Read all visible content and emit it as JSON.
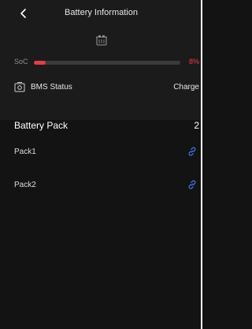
{
  "header": {
    "title": "Battery Information",
    "back_icon": "chevron-left-icon",
    "battery_icon": "battery-icon"
  },
  "soc": {
    "label": "SoC",
    "value_text": "8%",
    "percent": 8,
    "fill_color": "#ea3a48",
    "track_color": "#3a3a3a"
  },
  "bms": {
    "icon": "bms-status-icon",
    "label": "BMS Status",
    "value": "Charge"
  },
  "battery_pack": {
    "title": "Battery Pack",
    "count": "2",
    "packs": [
      {
        "name": "Pack1",
        "icon": "link-icon"
      },
      {
        "name": "Pack2",
        "icon": "link-icon"
      }
    ]
  },
  "colors": {
    "background": "#131313",
    "panel": "#1b1b1b",
    "accent_red": "#ea3a48",
    "link_blue": "#3d7bf0"
  }
}
